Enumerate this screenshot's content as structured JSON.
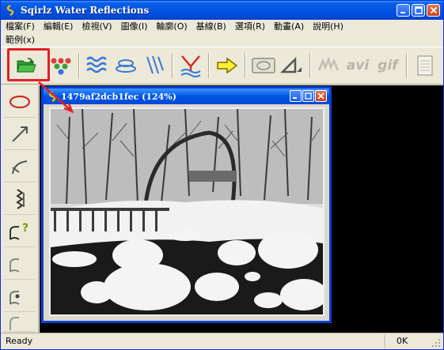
{
  "window": {
    "title": "Sqirlz Water Reflections"
  },
  "menu": {
    "row1": [
      "檔案(F)",
      "編輯(E)",
      "檢視(V)",
      "圖像(I)",
      "輪廓(O)",
      "基線(B)",
      "選項(R)",
      "動畫(A)",
      "說明(H)"
    ],
    "row2": [
      "範例(x)"
    ]
  },
  "toolbar": {
    "avi_label": "avi",
    "gif_label": "gif"
  },
  "child_window": {
    "title": "1479af2dcb1fec  (124%)"
  },
  "status": {
    "message": "Ready",
    "indicator": "0K"
  },
  "colors": {
    "accent_blue": "#0054e3",
    "highlight_red": "#e0202a",
    "workspace_bg": "#000000",
    "chrome": "#ece9d8"
  },
  "icons": [
    "app-icon",
    "open-folder-icon",
    "color-dots-icon",
    "wave-icon",
    "ellipse-ripple-icon",
    "rain-lines-icon",
    "filter-funnel-icon",
    "arrow-right-icon",
    "photo-frame-icon",
    "triangle-icon",
    "waves-disabled-icon",
    "document-icon",
    "ellipse-tool-icon",
    "line-tool-icon",
    "curve-tool-icon",
    "ripple-tool-icon",
    "help-tool-icon"
  ]
}
